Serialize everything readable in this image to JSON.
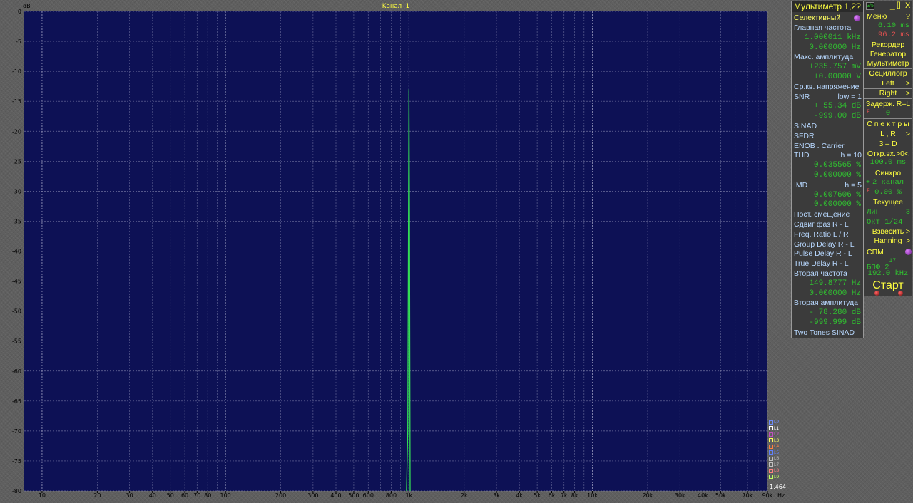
{
  "plot": {
    "channel_title": "Канал 1",
    "y_unit": "dB",
    "x_unit": "Hz",
    "corner_value": "1.464",
    "colors": {
      "background": "#0d1155",
      "grid": "#8e90b6",
      "trace": "#33dd55",
      "axis_text": "#000000"
    }
  },
  "chart_data": {
    "type": "line",
    "title": "Канал 1",
    "xlabel": "Hz",
    "ylabel": "dB",
    "x_scale": "log",
    "xlim": [
      8,
      90000
    ],
    "ylim": [
      -80,
      0
    ],
    "grid": true,
    "y_ticks": [
      0,
      -5,
      -10,
      -15,
      -20,
      -25,
      -30,
      -35,
      -40,
      -45,
      -50,
      -55,
      -60,
      -65,
      -70,
      -75,
      -80
    ],
    "y_tick_labels": [
      "0",
      "-5",
      "-10",
      "-15",
      "-20",
      "-25",
      "-30",
      "-35",
      "-40",
      "-45",
      "-50",
      "-55",
      "-60",
      "-65",
      "-70",
      "-75",
      "-80"
    ],
    "x_ticks": [
      10,
      20,
      30,
      40,
      50,
      60,
      70,
      80,
      100,
      200,
      300,
      400,
      500,
      600,
      800,
      1000,
      2000,
      3000,
      4000,
      5000,
      6000,
      7000,
      8000,
      10000,
      20000,
      30000,
      40000,
      50000,
      70000,
      90000
    ],
    "x_tick_labels": [
      "10",
      "20",
      "30",
      "40",
      "50",
      "60",
      "70",
      "80",
      "100",
      "200",
      "300",
      "400",
      "500",
      "600",
      "800",
      "1k",
      "2k",
      "3k",
      "4k",
      "5k",
      "6k",
      "7k",
      "8k",
      "10k",
      "20k",
      "30k",
      "40k",
      "50k",
      "70k",
      "90k"
    ],
    "series": [
      {
        "color": "#33dd55",
        "x": [
          970,
          985,
          1000,
          1007,
          1015
        ],
        "y": [
          -80,
          -70,
          -13,
          -34,
          -80
        ]
      }
    ]
  },
  "multimeter": {
    "title": "Мультиметр 1,2?",
    "mode_label": "Селективный",
    "rows": [
      {
        "kind": "label",
        "text": "Главная частота"
      },
      {
        "kind": "value",
        "text": "1.000011 kHz"
      },
      {
        "kind": "value",
        "text": "0.000000  Hz"
      },
      {
        "kind": "label",
        "text": "Макс. амплитуда"
      },
      {
        "kind": "value",
        "text": "+235.757 mV"
      },
      {
        "kind": "value",
        "text": "+0.00000  V"
      },
      {
        "kind": "label",
        "text": "Ср.кв. напряжение"
      },
      {
        "kind": "label_pair",
        "text": "SNR",
        "extra": "low =   1"
      },
      {
        "kind": "value",
        "text": "+ 55.34 dB"
      },
      {
        "kind": "value",
        "text": "-999.00 dB"
      },
      {
        "kind": "label",
        "text": "SINAD"
      },
      {
        "kind": "label",
        "text": "SFDR"
      },
      {
        "kind": "label",
        "text": "ENOB . Carrier"
      },
      {
        "kind": "label_pair",
        "text": "THD",
        "extra": "h =  10"
      },
      {
        "kind": "value",
        "text": "0.035565 %"
      },
      {
        "kind": "value",
        "text": "0.000000 %"
      },
      {
        "kind": "label_pair",
        "text": "IMD",
        "extra": "h =   5"
      },
      {
        "kind": "value",
        "text": "0.007606 %"
      },
      {
        "kind": "value",
        "text": "0.000000 %"
      },
      {
        "kind": "label",
        "text": "Пост. смещение"
      },
      {
        "kind": "label",
        "text": "Сдвиг фаз R - L"
      },
      {
        "kind": "label",
        "text": "Freq. Ratio  L / R"
      },
      {
        "kind": "label",
        "text": "Group Delay R - L"
      },
      {
        "kind": "label",
        "text": "Pulse Delay R - L"
      },
      {
        "kind": "label",
        "text": "True Delay R - L"
      },
      {
        "kind": "label",
        "text": "Вторая частота"
      },
      {
        "kind": "value",
        "text": "149.8777  Hz"
      },
      {
        "kind": "value",
        "text": "0.000000  Hz"
      },
      {
        "kind": "label",
        "text": "Вторая амплитуда"
      },
      {
        "kind": "value",
        "text": "- 78.280 dB"
      },
      {
        "kind": "value",
        "text": "-999.999 dB"
      },
      {
        "kind": "label",
        "text": "Two Tones SINAD"
      }
    ]
  },
  "controls": {
    "icon_text": "3/5",
    "minimize": "_",
    "maximize": "[]",
    "close": "X",
    "menu": "Меню",
    "help": "?",
    "time1": "6.10 ms",
    "time2": "96.2 ms",
    "recorder": "Рекордер",
    "generator": "Генератор",
    "multimeter": "Мультиметр",
    "oscilloscope": "Осциллогр",
    "left": "Left",
    "right": "Right",
    "arrow": ">",
    "delay": "Задерж. R–L",
    "delay_f": "F",
    "delay_val": "0",
    "spectra": "С п е к т р ы",
    "lr": "L , R",
    "three_d": "3 – D",
    "open_input": "Откр.вх.>0<",
    "open_input_val": "100.0 ms",
    "sync": "Синхро",
    "sync_plus": "+",
    "sync_channel": "2 канал",
    "sync_f": "F",
    "sync_pct": "0.00 %",
    "current": "Текущее",
    "lin": "Лин",
    "lin_val": "3",
    "oct": "Окт  1/24",
    "weigh": "Взвесить",
    "window": "Hanning",
    "spm": "СПМ",
    "fft": "БПФ  2",
    "fft_exp": "17",
    "sample_rate": "192.0 kHz",
    "start": "Старт"
  },
  "legend": [
    {
      "label": "L0",
      "color": "#6e8cff"
    },
    {
      "label": "L1",
      "color": "#ffffff"
    },
    {
      "label": "L2",
      "color": "#c050c0"
    },
    {
      "label": "L3",
      "color": "#ffff60"
    },
    {
      "label": "L4",
      "color": "#ff8040"
    },
    {
      "label": "L5",
      "color": "#6080ff"
    },
    {
      "label": "L6",
      "color": "#c0c0c0"
    },
    {
      "label": "L7",
      "color": "#c0c0c0"
    },
    {
      "label": "L8",
      "color": "#ff8080"
    },
    {
      "label": "L9",
      "color": "#c0ff60"
    }
  ]
}
